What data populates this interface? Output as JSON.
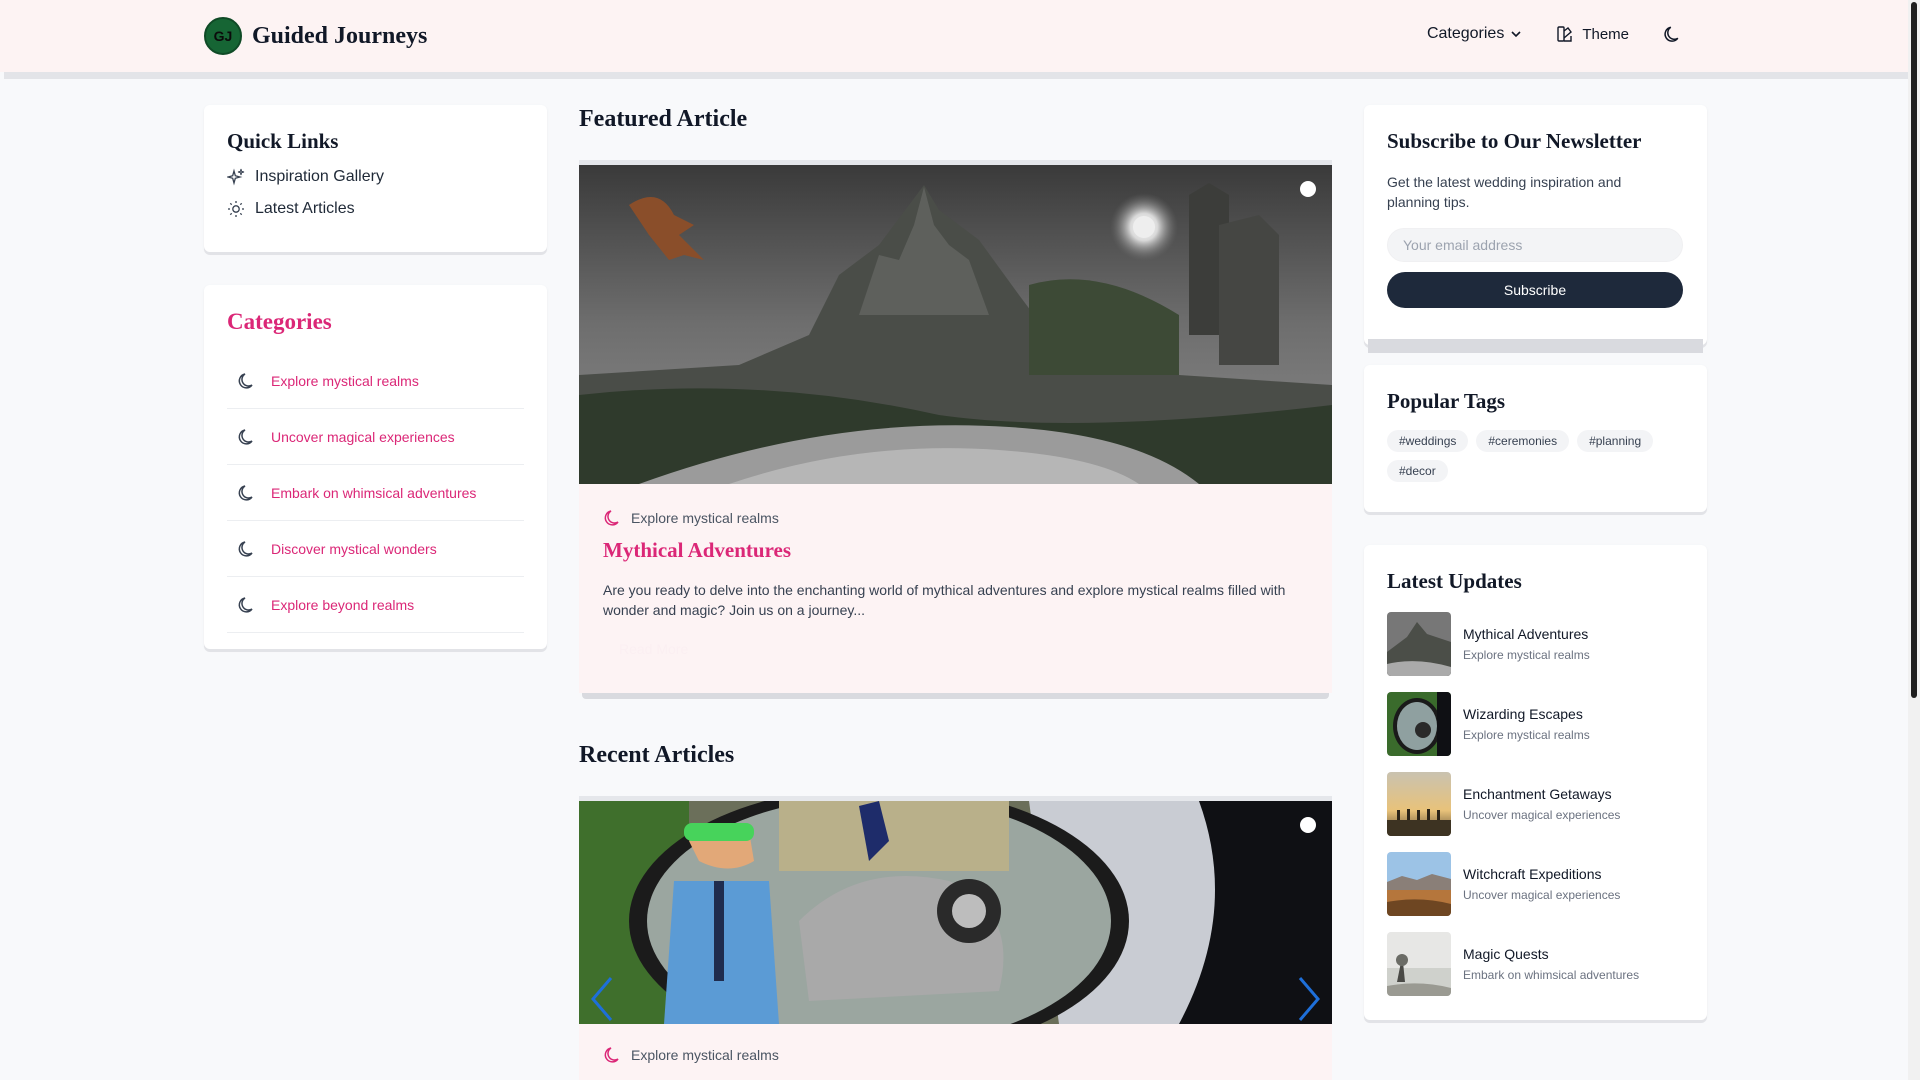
{
  "header": {
    "logo_initials": "GJ",
    "brand": "Guided Journeys",
    "nav_categories": "Categories",
    "nav_theme": "Theme"
  },
  "quick_links": {
    "title": "Quick Links",
    "items": [
      {
        "label": "Inspiration Gallery",
        "icon": "sparkles-icon"
      },
      {
        "label": "Latest Articles",
        "icon": "sun-icon"
      }
    ]
  },
  "categories": {
    "title": "Categories",
    "items": [
      {
        "label": "Explore mystical realms",
        "icon": "moon-icon"
      },
      {
        "label": "Uncover magical experiences",
        "icon": "moon-icon"
      },
      {
        "label": "Embark on whimsical adventures",
        "icon": "moon-icon"
      },
      {
        "label": "Discover mystical wonders",
        "icon": "moon-icon"
      },
      {
        "label": "Explore beyond realms",
        "icon": "moon-icon"
      }
    ]
  },
  "featured": {
    "section_title": "Featured Article",
    "category": "Explore mystical realms",
    "title": "Mythical Adventures",
    "description": "Are you ready to delve into the enchanting world of mythical adventures and explore mystical realms filled with wonder and magic? Join us on a journey...",
    "read_more": "Read More"
  },
  "recent": {
    "section_title": "Recent Articles",
    "category": "Explore mystical realms"
  },
  "newsletter": {
    "title": "Subscribe to Our Newsletter",
    "text": "Get the latest wedding inspiration and planning tips.",
    "email_placeholder": "Your email address",
    "button": "Subscribe"
  },
  "tags": {
    "title": "Popular Tags",
    "items": [
      "#weddings",
      "#ceremonies",
      "#planning",
      "#decor"
    ]
  },
  "updates": {
    "title": "Latest Updates",
    "items": [
      {
        "title": "Mythical Adventures",
        "subtitle": "Explore mystical realms"
      },
      {
        "title": "Wizarding Escapes",
        "subtitle": "Explore mystical realms"
      },
      {
        "title": "Enchantment Getaways",
        "subtitle": "Uncover magical experiences"
      },
      {
        "title": "Witchcraft Expeditions",
        "subtitle": "Uncover magical experiences"
      },
      {
        "title": "Magic Quests",
        "subtitle": "Embark on whimsical adventures"
      }
    ]
  },
  "colors": {
    "accent": "#db2777",
    "header_bg": "#fdf3f3",
    "button_dark": "#1e293b",
    "logo_green": "#166534"
  }
}
